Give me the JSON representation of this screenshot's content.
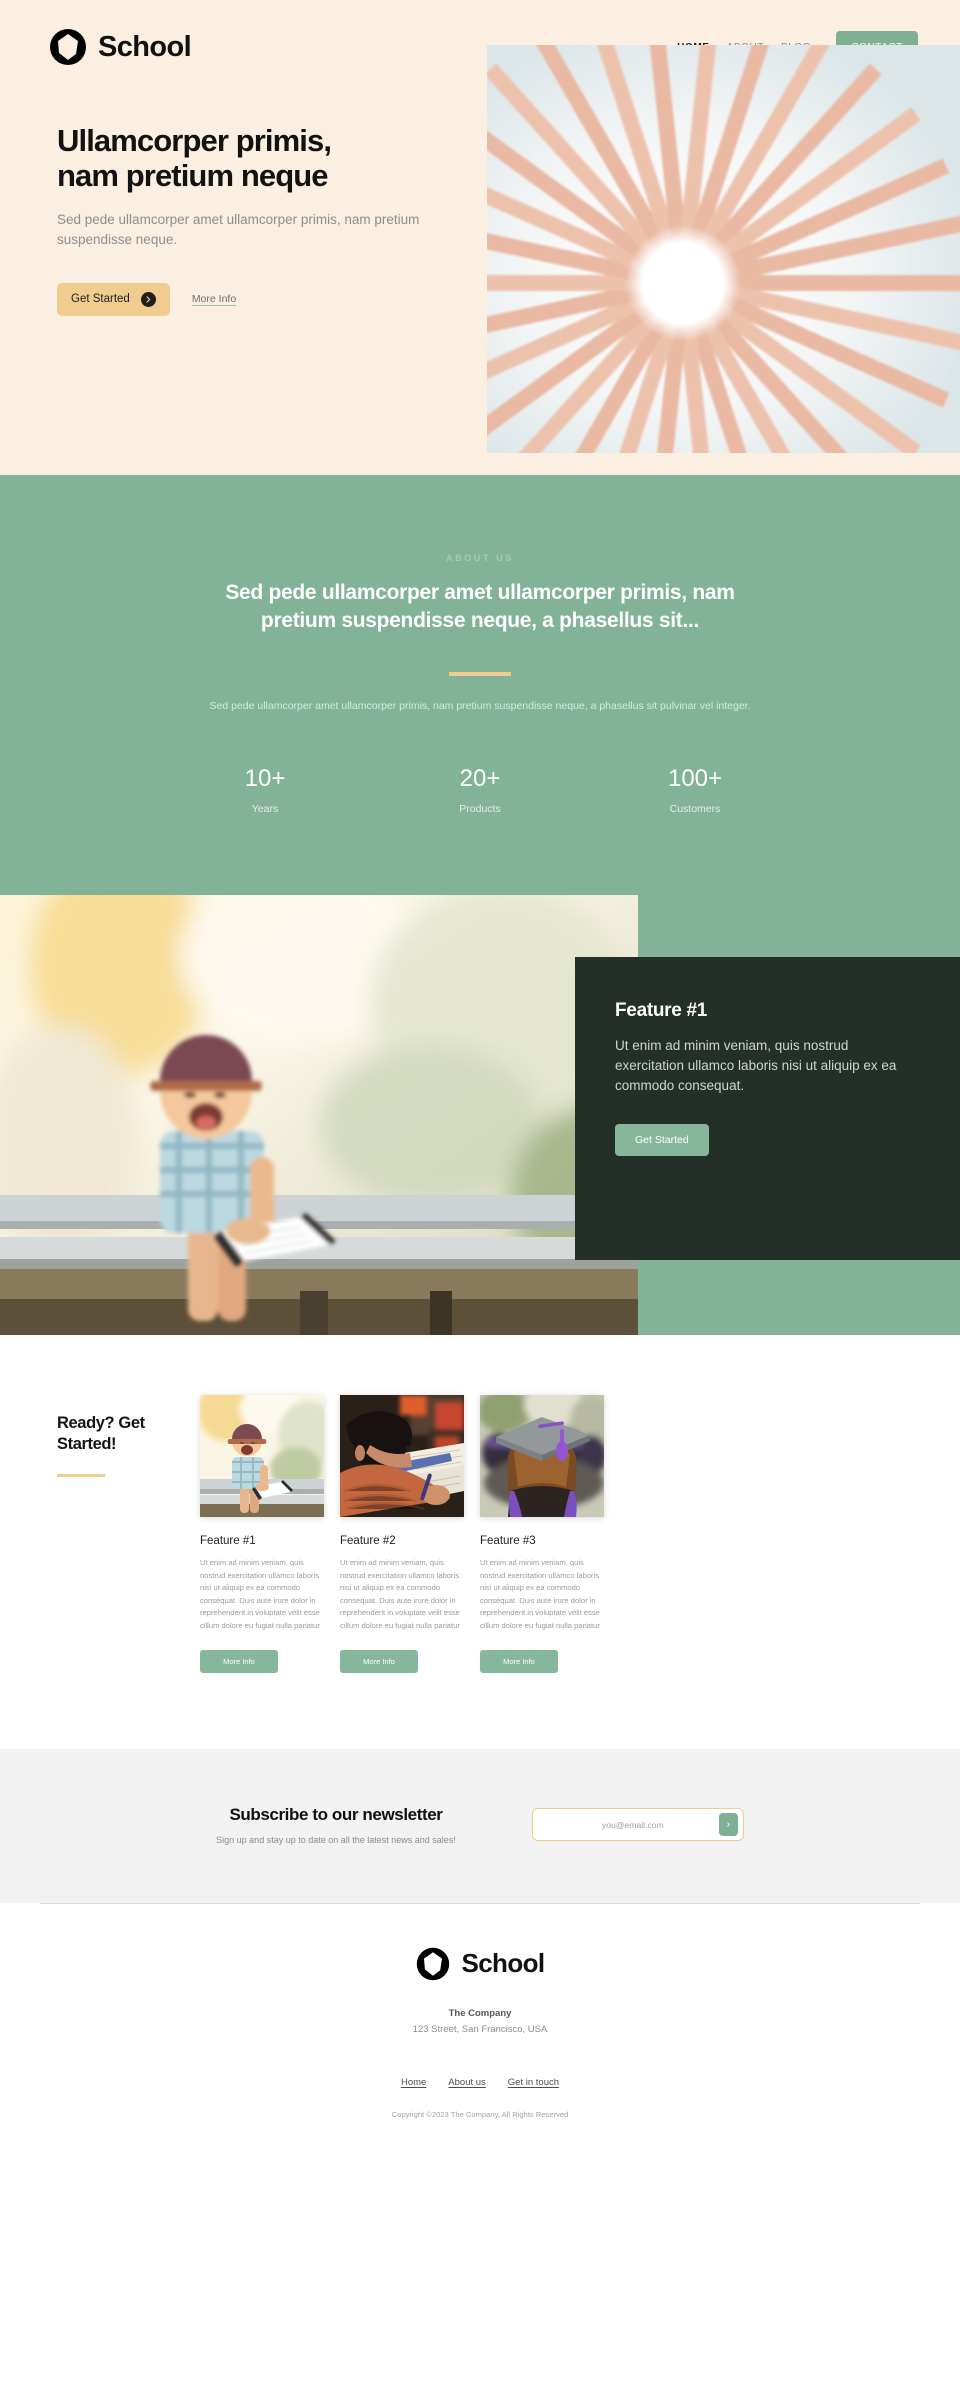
{
  "brand": {
    "name": "School",
    "logo_icon": "circle-polygon-logo-icon"
  },
  "nav": {
    "links": [
      {
        "label": "HOME",
        "active": true
      },
      {
        "label": "ABOUT",
        "active": false
      },
      {
        "label": "BLOG",
        "active": false
      }
    ],
    "cta_label": "CONTACT"
  },
  "hero": {
    "title_line1": "Ullamcorper primis,",
    "title_line2": "nam pretium neque",
    "subtitle": "Sed pede ullamcorper amet ullamcorper primis, nam pretium suspendisse neque.",
    "primary_button": "Get Started",
    "primary_button_icon": "arrow-right-circle-icon",
    "secondary_link": "More Info",
    "image_alt": "colored-pencils-radial-circle-photo"
  },
  "about": {
    "eyebrow": "ABOUT US",
    "title": "Sed pede ullamcorper amet ullamcorper primis, nam pretium suspendisse neque, a phasellus sit...",
    "body": "Sed pede ullamcorper amet ullamcorper primis, nam pretium suspendisse neque, a phasellus sit pulvinar vel integer.",
    "stats": [
      {
        "value": "10+",
        "label": "Years"
      },
      {
        "value": "20+",
        "label": "Products"
      },
      {
        "value": "100+",
        "label": "Customers"
      }
    ]
  },
  "feature_split": {
    "image_alt": "laughing-boy-with-book-on-bench-photo",
    "title": "Feature #1",
    "body": "Ut enim ad minim veniam, quis nostrud exercitation ullamco laboris nisi ut aliquip ex ea commodo consequat.",
    "button": "Get Started"
  },
  "cards_section": {
    "heading": "Ready? Get Started!",
    "cards": [
      {
        "title": "Feature #1",
        "body": "Ut enim ad minim veniam, quis nostrud exercitation ullamco laboris nisi ut aliquip ex ea commodo consequat. Duis aute irure dolor in reprehenderit in voluptate velit esse cillum dolore eu fugiat nulla pariatur",
        "button": "More Info",
        "image_alt": "laughing-boy-with-book-on-bench-photo"
      },
      {
        "title": "Feature #2",
        "body": "Ut enim ad minim veniam, quis nostrud exercitation ullamco laboris nisi ut aliquip ex ea commodo consequat. Duis aute irure dolor in reprehenderit in voluptate velit esse cillum dolore eu fugiat nulla pariatur",
        "button": "More Info",
        "image_alt": "child-writing-at-desk-photo"
      },
      {
        "title": "Feature #3",
        "body": "Ut enim ad minim veniam, quis nostrud exercitation ullamco laboris nisi ut aliquip ex ea commodo consequat. Duis aute irure dolor in reprehenderit in voluptate velit esse cillum dolore eu fugiat nulla pariatur",
        "button": "More Info",
        "image_alt": "graduate-with-cap-and-purple-tassel-photo"
      }
    ]
  },
  "newsletter": {
    "heading": "Subscribe to our newsletter",
    "subtext": "Sign up and stay up to date on all the latest news and sales!",
    "input_value": "",
    "input_placeholder": "you@email.com",
    "submit_icon": "chevron-right-icon",
    "submit_label": "›"
  },
  "footer": {
    "company": "The Company",
    "address": "123 Street, San Francisco, USA",
    "links": [
      {
        "label": "Home"
      },
      {
        "label": "About us"
      },
      {
        "label": "Get in touch"
      }
    ],
    "copyright": "Copyright ©2023 The Company, All Rights Reserved"
  },
  "colors": {
    "cream": "#faefe0",
    "green": "#82b298",
    "green_button": "#7fb094",
    "gold": "#f0cd8e",
    "dark_card": "#232f27",
    "light_gray_section": "#f2f2f2"
  }
}
